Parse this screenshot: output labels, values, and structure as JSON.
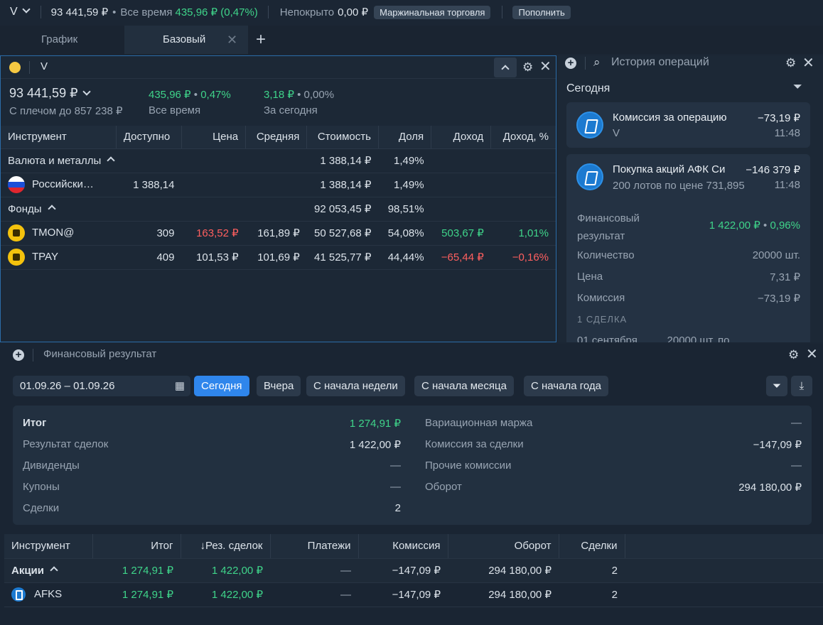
{
  "topbar": {
    "account": "V",
    "balance": "93 441,59 ₽",
    "all_time_label": "Все время",
    "all_time_value": "435,96 ₽ (0,47%)",
    "uncovered_label": "Непокрыто",
    "uncovered_value": "0,00 ₽",
    "margin_button": "Маржинальная торговля",
    "topup_button": "Пополнить"
  },
  "tabs": [
    {
      "label": "График"
    },
    {
      "label": "Базовый"
    }
  ],
  "portfolio": {
    "title": "V",
    "total": "93 441,59 ₽",
    "leverage": "С плечом до 857 238 ₽",
    "all_time_value": "435,96 ₽",
    "all_time_pct": "0,47%",
    "all_time_label": "Все время",
    "today_value": "3,18 ₽",
    "today_pct": "0,00%",
    "today_label": "За сегодня",
    "columns": [
      "Инструмент",
      "Доступно",
      "Цена",
      "Средняя",
      "Стоимость",
      "Доля",
      "Доход",
      "Доход, %"
    ],
    "groups": [
      {
        "name": "Валюта и металлы",
        "cost": "1 388,14 ₽",
        "share": "1,49%",
        "rows": [
          {
            "name": "Российски…",
            "avail": "1 388,14",
            "price": "",
            "avg": "",
            "cost": "1 388,14 ₽",
            "share": "1,49%",
            "income": "",
            "income_pct": ""
          }
        ]
      },
      {
        "name": "Фонды",
        "cost": "92 053,45 ₽",
        "share": "98,51%",
        "rows": [
          {
            "name": "TMON@",
            "avail": "309",
            "price": "163,52 ₽",
            "avg": "161,89 ₽",
            "cost": "50 527,68 ₽",
            "share": "54,08%",
            "income": "503,67 ₽",
            "income_pct": "1,01%"
          },
          {
            "name": "TPAY",
            "avail": "409",
            "price": "101,53 ₽",
            "avg": "101,69 ₽",
            "cost": "41 525,77 ₽",
            "share": "44,44%",
            "income": "−65,44 ₽",
            "income_pct": "−0,16%"
          }
        ]
      }
    ]
  },
  "history": {
    "title": "История операций",
    "section": "Сегодня",
    "op1": {
      "title": "Комиссия за операцию",
      "amount": "−73,19 ₽",
      "sub": "V",
      "time": "11:48"
    },
    "op2": {
      "title": "Покупка акций АФК Си",
      "amount": "−146 379 ₽",
      "sub": "200 лотов по цене 731,895 ₽",
      "time": "11:48",
      "finres_label": "Финансовый результат",
      "finres_value": "1 422,00 ₽",
      "finres_pct": "0,96%",
      "qty_label": "Количество",
      "qty_value": "20000 шт.",
      "price_label": "Цена",
      "price_value": "7,31 ₽",
      "fee_label": "Комиссия",
      "fee_value": "−73,19 ₽",
      "deals_label": "1 СДЕЛКА",
      "deal_row": "01 сентября          20000 шт. по"
    }
  },
  "finres": {
    "title": "Финансовый результат",
    "date_range": "01.09.26 – 01.09.26",
    "periods": [
      "Сегодня",
      "Вчера",
      "С начала недели",
      "С начала месяца",
      "С начала года"
    ],
    "left": [
      {
        "label": "Итог",
        "value": "1 274,91 ₽"
      },
      {
        "label": "Результат сделок",
        "value": "1 422,00 ₽"
      },
      {
        "label": "Дивиденды",
        "value": "—"
      },
      {
        "label": "Купоны",
        "value": "—"
      },
      {
        "label": "Сделки",
        "value": "2"
      }
    ],
    "right": [
      {
        "label": "Вариационная маржа",
        "value": "—"
      },
      {
        "label": "Комиссия за сделки",
        "value": "−147,09 ₽"
      },
      {
        "label": "Прочие комиссии",
        "value": "—"
      },
      {
        "label": "Оборот",
        "value": "294 180,00 ₽"
      }
    ],
    "columns": [
      "Инструмент",
      "Итог",
      "Рез. сделок",
      "Платежи",
      "Комиссия",
      "Оборот",
      "Сделки"
    ],
    "group": {
      "name": "Акции",
      "total": "1 274,91 ₽",
      "deals_res": "1 422,00 ₽",
      "payments": "—",
      "fee": "−147,09 ₽",
      "turnover": "294 180,00 ₽",
      "count": "2"
    },
    "row": {
      "name": "AFKS",
      "total": "1 274,91 ₽",
      "deals_res": "1 422,00 ₽",
      "payments": "—",
      "fee": "−147,09 ₽",
      "turnover": "294 180,00 ₽",
      "count": "2"
    }
  }
}
